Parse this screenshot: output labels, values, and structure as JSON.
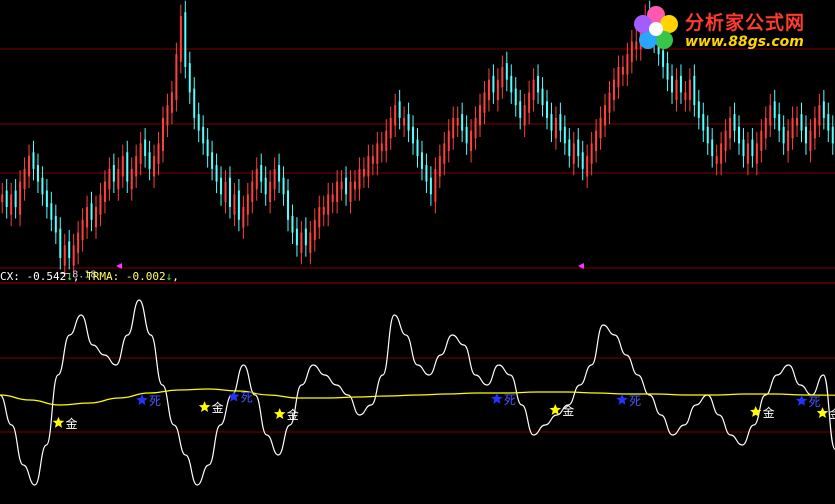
{
  "logo": {
    "brand": "分析家公式网",
    "url": "www.88gs.com"
  },
  "indicator": {
    "name": "CX",
    "value": "-0.542",
    "arrow": "↓",
    "ma_name": "TRMA",
    "ma_value": "-0.002",
    "ma_arrow": "↓"
  },
  "price_low_label": "8.18",
  "signal_labels": {
    "gold": "金",
    "dead": "死"
  },
  "colors": {
    "up": "#ff4040",
    "down": "#54ffff",
    "osc": "#ffffff",
    "ma": "#ffff00",
    "grid": "#7a0000",
    "gold_star": "#ffff00",
    "dead_star": "#2233ff"
  },
  "chart_data": [
    {
      "type": "candlestick",
      "title": "",
      "annotations": [
        {
          "text": "8.18",
          "kind": "low-marker"
        }
      ],
      "series": [
        {
          "values": [
            6,
            5,
            6,
            5,
            7,
            8,
            9,
            8,
            7,
            6,
            5,
            4,
            3,
            1,
            2,
            1,
            2,
            3,
            4,
            5,
            4,
            5,
            6,
            7,
            8,
            7,
            8,
            9,
            7,
            8,
            9,
            10,
            9,
            8,
            9,
            10,
            12,
            13,
            14,
            17,
            20,
            16,
            14,
            12,
            11,
            10,
            9,
            8,
            7,
            6,
            7,
            5,
            6,
            4,
            5,
            6,
            7,
            8,
            7,
            6,
            7,
            8,
            7,
            6,
            4,
            3,
            2,
            3,
            2,
            3,
            4,
            5,
            5,
            6,
            6,
            7,
            7,
            6,
            7,
            7,
            8,
            8,
            9,
            9,
            10,
            10,
            11,
            12,
            13,
            12,
            12,
            11,
            10,
            9,
            8,
            7,
            6,
            8,
            9,
            10,
            11,
            12,
            12,
            11,
            10,
            11,
            12,
            13,
            14,
            15,
            14,
            15,
            16,
            15,
            14,
            13,
            12,
            13,
            14,
            15,
            14,
            13,
            12,
            11,
            12,
            11,
            10,
            9,
            10,
            9,
            8,
            9,
            10,
            11,
            12,
            13,
            14,
            15,
            16,
            16,
            17,
            18,
            18,
            19,
            20,
            19,
            18,
            17,
            16,
            15,
            14,
            15,
            14,
            14,
            15,
            13,
            12,
            11,
            10,
            9,
            9,
            10,
            11,
            12,
            11,
            10,
            9,
            10,
            9,
            10,
            11,
            12,
            13,
            12,
            11,
            10,
            11,
            12,
            12,
            11,
            10,
            11,
            12,
            13,
            12,
            11,
            10
          ]
        }
      ]
    },
    {
      "type": "line",
      "title": "",
      "ylim": [
        -1,
        1
      ],
      "series": [
        {
          "name": "CX",
          "values": [
            0.0,
            -0.3,
            -0.7,
            -0.9,
            -0.5,
            0.2,
            0.6,
            0.8,
            0.5,
            0.4,
            0.3,
            0.6,
            0.95,
            0.6,
            0.1,
            -0.3,
            -0.6,
            -0.9,
            -0.7,
            -0.3,
            0.0,
            0.3,
            0.0,
            -0.4,
            -0.6,
            -0.3,
            0.1,
            0.3,
            0.2,
            0.1,
            0.0,
            -0.2,
            -0.1,
            0.2,
            0.8,
            0.6,
            0.3,
            0.2,
            0.4,
            0.6,
            0.5,
            0.2,
            0.1,
            0.3,
            0.2,
            -0.1,
            -0.4,
            -0.3,
            -0.2,
            -0.1,
            0.1,
            0.3,
            0.7,
            0.6,
            0.4,
            0.2,
            0.0,
            -0.2,
            -0.4,
            -0.3,
            -0.1,
            0.0,
            -0.2,
            -0.4,
            -0.5,
            -0.3,
            0.0,
            0.2,
            0.3,
            0.1,
            0.0,
            0.2,
            -0.542
          ]
        },
        {
          "name": "TRMA",
          "values": [
            0.0,
            -0.05,
            -0.1,
            -0.08,
            -0.03,
            0.02,
            0.05,
            0.06,
            0.04,
            0.0,
            -0.03,
            -0.03,
            -0.02,
            -0.01,
            0.0,
            0.01,
            0.02,
            0.02,
            0.03,
            0.03,
            0.02,
            0.01,
            0.01,
            0.0,
            0.0,
            0.01,
            0.01,
            0.0,
            -0.002
          ]
        }
      ],
      "signals": [
        {
          "type": "gold",
          "label": "金",
          "at": 0.07
        },
        {
          "type": "dead",
          "label": "死",
          "at": 0.17
        },
        {
          "type": "gold",
          "label": "金",
          "at": 0.245
        },
        {
          "type": "dead",
          "label": "死",
          "at": 0.28
        },
        {
          "type": "gold",
          "label": "金",
          "at": 0.335
        },
        {
          "type": "dead",
          "label": "死",
          "at": 0.595
        },
        {
          "type": "gold",
          "label": "金",
          "at": 0.665
        },
        {
          "type": "dead",
          "label": "死",
          "at": 0.745
        },
        {
          "type": "gold",
          "label": "金",
          "at": 0.905
        },
        {
          "type": "dead",
          "label": "死",
          "at": 0.96
        },
        {
          "type": "gold",
          "label": "金",
          "at": 0.985
        }
      ]
    }
  ]
}
